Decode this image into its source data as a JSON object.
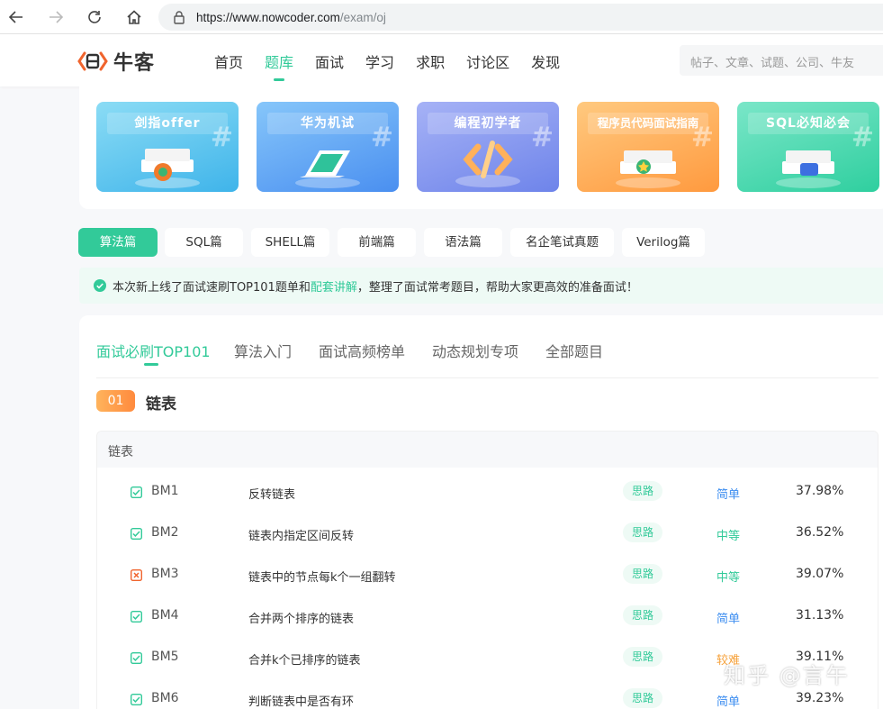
{
  "browser": {
    "url_host": "https://www.nowcoder.com",
    "url_path": "/exam/oj"
  },
  "header": {
    "logo_text": "牛客",
    "nav": [
      "首页",
      "题库",
      "面试",
      "学习",
      "求职",
      "讨论区",
      "发现"
    ],
    "active_nav": "题库",
    "search_placeholder": "帖子、文章、试题、公司、牛友"
  },
  "banners": [
    {
      "title": "剑指offer",
      "color_start": "#7fd6f3",
      "color_end": "#3fb4ea"
    },
    {
      "title": "华为机试",
      "color_start": "#79bdf8",
      "color_end": "#4a8ff0"
    },
    {
      "title": "编程初学者",
      "color_start": "#9aa9f5",
      "color_end": "#6e84ea"
    },
    {
      "title": "程序员代码面试指南",
      "color_start": "#ffc278",
      "color_end": "#ff9a3f"
    },
    {
      "title": "SQL必知必会",
      "color_start": "#6fe3c3",
      "color_end": "#2fcf9f"
    }
  ],
  "categories": [
    "算法篇",
    "SQL篇",
    "SHELL篇",
    "前端篇",
    "语法篇",
    "名企笔试真题",
    "Verilog篇"
  ],
  "active_category": "算法篇",
  "notice": {
    "before": "本次新上线了面试速刷TOP101题单和",
    "link": "配套讲解",
    "after": "，整理了面试常考题目，帮助大家更高效的准备面试！"
  },
  "sub_tabs": [
    "面试必刷TOP101",
    "算法入门",
    "面试高频榜单",
    "动态规划专项",
    "全部题目"
  ],
  "active_sub_tab": "面试必刷TOP101",
  "section": {
    "number": "01",
    "title": "链表"
  },
  "list": {
    "header": "链表",
    "tag_label": "思路",
    "rows": [
      {
        "id": "BM1",
        "name": "反转链表",
        "difficulty": "简单",
        "difficulty_color": "#3d8ef0",
        "rate": "37.98%",
        "status": "done"
      },
      {
        "id": "BM2",
        "name": "链表内指定区间反转",
        "difficulty": "中等",
        "difficulty_color": "#32ca99",
        "rate": "36.52%",
        "status": "done"
      },
      {
        "id": "BM3",
        "name": "链表中的节点每k个一组翻转",
        "difficulty": "中等",
        "difficulty_color": "#32ca99",
        "rate": "39.07%",
        "status": "wrong"
      },
      {
        "id": "BM4",
        "name": "合并两个排序的链表",
        "difficulty": "简单",
        "difficulty_color": "#3d8ef0",
        "rate": "31.13%",
        "status": "done"
      },
      {
        "id": "BM5",
        "name": "合并k个已排序的链表",
        "difficulty": "较难",
        "difficulty_color": "#f6a13a",
        "rate": "39.11%",
        "status": "done"
      },
      {
        "id": "BM6",
        "name": "判断链表中是否有环",
        "difficulty": "简单",
        "difficulty_color": "#3d8ef0",
        "rate": "39.23%",
        "status": "done"
      }
    ]
  },
  "watermark": "知乎 @言午",
  "colors": {
    "accent": "#32ca99",
    "wrong": "#f0642d"
  }
}
